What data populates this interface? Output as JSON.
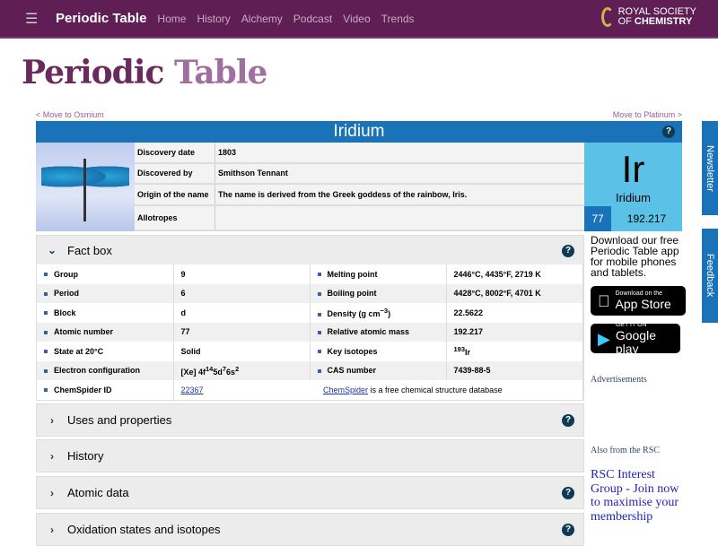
{
  "header": {
    "brand": "Periodic Table",
    "nav": [
      "Home",
      "History",
      "Alchemy",
      "Podcast",
      "Video",
      "Trends"
    ],
    "logo_line1": "ROYAL SOCIETY",
    "logo_line2_a": "OF ",
    "logo_line2_b": "CHEMISTRY"
  },
  "page_title_a": "Periodic",
  "page_title_b": "Table",
  "prev_link": "< Move to Osmium",
  "next_link": "Move to Platinum >",
  "element": {
    "name": "Iridium",
    "symbol": "Ir",
    "number": "77",
    "mass": "192.217"
  },
  "info": [
    {
      "k": "Discovery date",
      "v": "1803"
    },
    {
      "k": "Discovered by",
      "v": "Smithson Tennant"
    },
    {
      "k": "Origin of the name",
      "v": "The name is derived from the Greek goddess of the rainbow, Iris."
    },
    {
      "k": "Allotropes",
      "v": ""
    }
  ],
  "factbox": {
    "title": "Fact box",
    "rows": [
      {
        "k1": "Group",
        "v1": "9",
        "k2": "Melting point",
        "v2": "2446°C, 4435°F, 2719 K"
      },
      {
        "k1": "Period",
        "v1": "6",
        "k2": "Boiling point",
        "v2": "4428°C, 8002°F, 4701 K"
      },
      {
        "k1": "Block",
        "v1": "d",
        "k2": "Density (g cm",
        "v2": "22.5622"
      },
      {
        "k1": "Atomic number",
        "v1": "77",
        "k2": "Relative atomic mass",
        "v2": "192.217"
      },
      {
        "k1": "State at 20°C",
        "v1": "Solid",
        "k2": "Key isotopes",
        "v2": "Ir"
      },
      {
        "k1": "Electron configuration",
        "v1": "[Xe] 4f",
        "k2": "CAS number",
        "v2": "7439-88-5"
      }
    ],
    "density_sup": "−3",
    "isotope_sup": "193",
    "ec_sup1": "14",
    "ec_mid1": "5d",
    "ec_sup2": "7",
    "ec_mid2": "6s",
    "ec_sup3": "2",
    "chemspider_label": "ChemSpider ID",
    "chemspider_id": "22367",
    "chemspider_link": "ChemSpider",
    "chemspider_text": " is a free chemical structure database"
  },
  "sections": [
    "Uses and properties",
    "History",
    "Atomic data",
    "Oxidation states and isotopes"
  ],
  "sidebar": {
    "app_text": "Download our free Periodic Table app for mobile phones and tablets.",
    "appstore_small": "Download on the",
    "appstore_big": "App Store",
    "gplay_small": "GET IT ON",
    "gplay_big": "Google play",
    "ads": "Advertisements",
    "also": "Also from the RSC",
    "rsc_link": "RSC Interest Group - Join now to maximise your membership"
  },
  "tabs": {
    "newsletter": "Newsletter",
    "feedback": "Feedback"
  }
}
